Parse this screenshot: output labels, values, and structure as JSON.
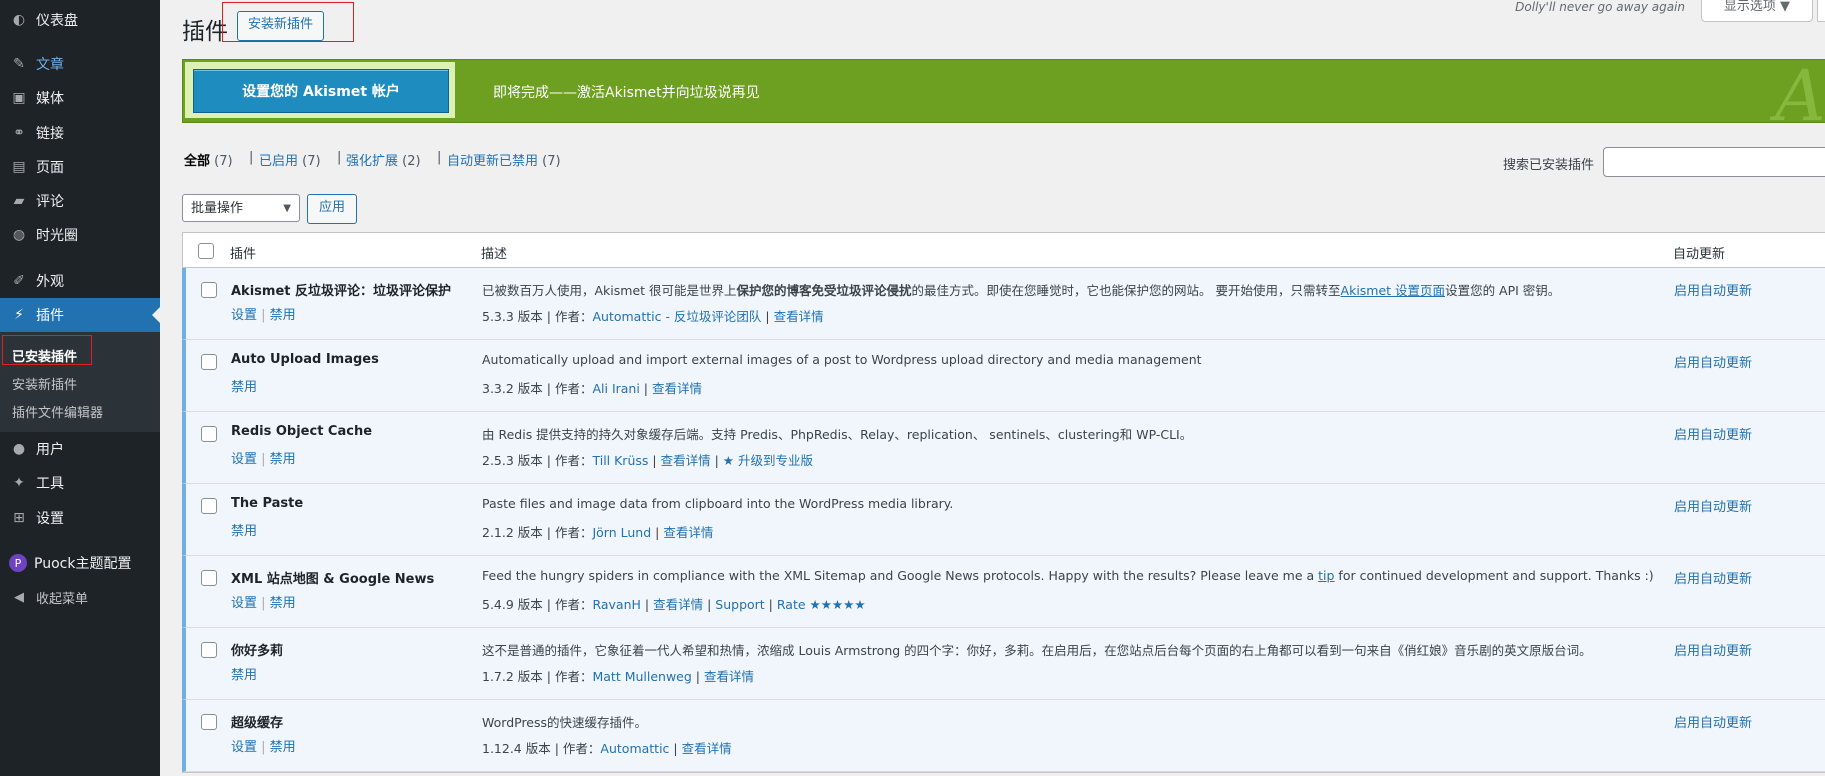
{
  "sidebar": {
    "items": [
      {
        "id": "dashboard",
        "label": "仪表盘",
        "icon": "dashboard-icon",
        "glyph": "◐"
      },
      {
        "id": "posts",
        "label": "文章",
        "icon": "pin-icon",
        "glyph": "✎"
      },
      {
        "id": "media",
        "label": "媒体",
        "icon": "media-icon",
        "glyph": "▣"
      },
      {
        "id": "links",
        "label": "链接",
        "icon": "link-icon",
        "glyph": "⚭"
      },
      {
        "id": "pages",
        "label": "页面",
        "icon": "page-icon",
        "glyph": "▤"
      },
      {
        "id": "comments",
        "label": "评论",
        "icon": "comment-icon",
        "glyph": "▰"
      },
      {
        "id": "moments",
        "label": "时光圈",
        "icon": "chat-bubble-icon",
        "glyph": "◍"
      },
      {
        "id": "appearance",
        "label": "外观",
        "icon": "paintbrush-icon",
        "glyph": "✐"
      },
      {
        "id": "plugins",
        "label": "插件",
        "icon": "plugin-icon",
        "glyph": "⚡"
      },
      {
        "id": "users",
        "label": "用户",
        "icon": "user-icon",
        "glyph": "●"
      },
      {
        "id": "tools",
        "label": "工具",
        "icon": "wrench-icon",
        "glyph": "✦"
      },
      {
        "id": "settings",
        "label": "设置",
        "icon": "settings-icon",
        "glyph": "⊞"
      },
      {
        "id": "puock",
        "label": "Puock主题配置",
        "icon": "puock-logo-icon",
        "glyph": "P"
      },
      {
        "id": "collapse",
        "label": "收起菜单",
        "icon": "collapse-icon",
        "glyph": "◀"
      }
    ],
    "submenu": [
      "已安装插件",
      "安装新插件",
      "插件文件编辑器"
    ]
  },
  "header": {
    "title": "插件",
    "add_new": "安装新插件",
    "dolly": "Dolly'll never go away again",
    "screen_options": "显示选项 ▼"
  },
  "akismet": {
    "button": "设置您的 Akismet 帐户",
    "text": "即将完成——激活Akismet并向垃圾说再见",
    "logo": "A"
  },
  "filters": {
    "all": "全部",
    "all_count": "(7)",
    "active": "已启用",
    "active_count": "(7)",
    "must_use": "强化扩展",
    "must_use_count": "(2)",
    "auto_disabled": "自动更新已禁用",
    "auto_disabled_count": "(7)",
    "sep": "|"
  },
  "search": {
    "label": "搜索已安装插件",
    "value": ""
  },
  "bulk": {
    "select": "批量操作",
    "apply": "应用"
  },
  "table": {
    "headers": {
      "plugin": "插件",
      "description": "描述",
      "auto": "自动更新"
    },
    "rows": [
      {
        "name": "Akismet 反垃圾评论：垃圾评论保护",
        "actions": [
          "设置",
          "禁用"
        ],
        "desc_pre": "已被数百万人使用，Akismet 很可能是世界上",
        "desc_bold": "保护您的博客免受垃圾评论侵扰",
        "desc_mid": "的最佳方式。即使在您睡觉时，它也能保护您的网站。 要开始使用，只需转至",
        "desc_link": "Akismet 设置页面",
        "desc_post": "设置您的 API 密钥。",
        "version": "5.3.3 版本",
        "author_label": "作者：",
        "author": "Automattic - 反垃圾评论团队",
        "links": [
          "查看详情"
        ],
        "auto": "启用自动更新"
      },
      {
        "name": "Auto Upload Images",
        "actions": [
          "禁用"
        ],
        "desc_pre": "Automatically upload and import external images of a post to Wordpress upload directory and media management",
        "version": "3.3.2 版本",
        "author_label": "作者：",
        "author": "Ali Irani",
        "links": [
          "查看详情"
        ],
        "auto": "启用自动更新"
      },
      {
        "name": "Redis Object Cache",
        "actions": [
          "设置",
          "禁用"
        ],
        "desc_pre": "由 Redis 提供支持的持久对象缓存后端。支持 Predis、PhpRedis、Relay、replication、 sentinels、clustering和 WP-CLI。",
        "version": "2.5.3 版本",
        "author_label": "作者：",
        "author": "Till Krüss",
        "links": [
          "查看详情",
          "★ 升级到专业版"
        ],
        "auto": "启用自动更新"
      },
      {
        "name": "The Paste",
        "actions": [
          "禁用"
        ],
        "desc_pre": "Paste files and image data from clipboard into the WordPress media library.",
        "version": "2.1.2 版本",
        "author_label": "作者：",
        "author": "Jörn Lund",
        "links": [
          "查看详情"
        ],
        "auto": "启用自动更新"
      },
      {
        "name": "XML 站点地图 & Google News",
        "actions": [
          "设置",
          "禁用"
        ],
        "desc_pre": "Feed the hungry spiders in compliance with the XML Sitemap and Google News protocols. Happy with the results? Please leave me a ",
        "desc_link": "tip",
        "desc_post": " for continued development and support. Thanks :)",
        "version": "5.4.9 版本",
        "author_label": "作者：",
        "author": "RavanH",
        "links": [
          "查看详情",
          "Support",
          "Rate ★★★★★"
        ],
        "auto": "启用自动更新"
      },
      {
        "name": "你好多莉",
        "actions": [
          "禁用"
        ],
        "desc_pre": "这不是普通的插件，它象征着一代人希望和热情，浓缩成 Louis Armstrong 的四个字：你好，多莉。在启用后，在您站点后台每个页面的右上角都可以看到一句来自《俏红娘》音乐剧的英文原版台词。",
        "version": "1.7.2 版本",
        "author_label": "作者：",
        "author": "Matt Mullenweg",
        "links": [
          "查看详情"
        ],
        "auto": "启用自动更新"
      },
      {
        "name": "超级缓存",
        "actions": [
          "设置",
          "禁用"
        ],
        "desc_pre": "WordPress的快速缓存插件。",
        "version": "1.12.4 版本",
        "author_label": "作者：",
        "author": "Automattic",
        "links": [
          "查看详情"
        ],
        "auto": "启用自动更新"
      }
    ]
  }
}
